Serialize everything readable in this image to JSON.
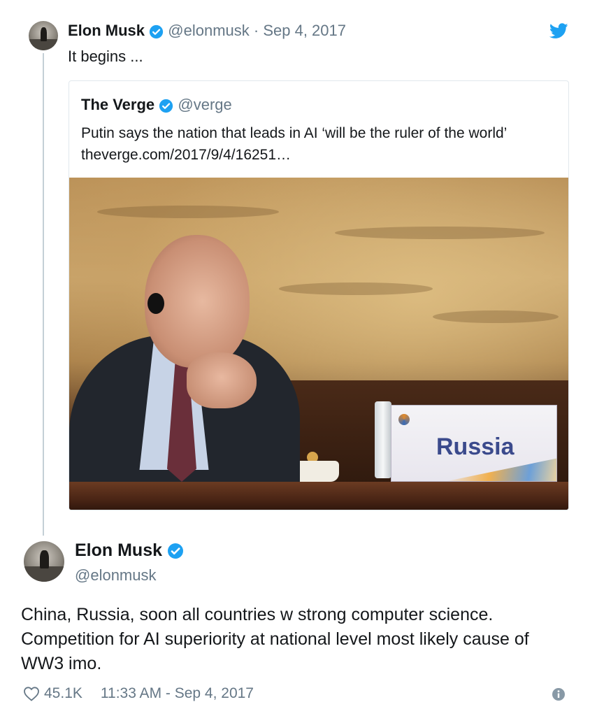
{
  "top_tweet": {
    "author_name": "Elon Musk",
    "handle": "@elonmusk",
    "separator": "·",
    "date": "Sep 4, 2017",
    "text": "It begins ..."
  },
  "quote_tweet": {
    "author_name": "The Verge",
    "handle": "@verge",
    "text": "Putin says the nation that leads in AI ‘will be the ruler of the world’ theverge.com/2017/9/4/16251…",
    "image": {
      "nameplate_text": "Russia"
    }
  },
  "second_tweet": {
    "author_name": "Elon Musk",
    "handle": "@elonmusk",
    "text": "China, Russia, soon all countries w strong computer science. Competition for AI superiority at national level most likely cause of WW3 imo.",
    "likes": "45.1K",
    "timestamp": "11:33 AM - Sep 4, 2017"
  },
  "icons": {
    "verified": "verified-badge-icon",
    "twitter": "twitter-bird-icon",
    "like": "heart-icon",
    "info": "info-icon"
  },
  "colors": {
    "twitter_blue": "#1da1f2",
    "muted_text": "#657786",
    "thread_line": "#c4cfd6",
    "card_border": "#e1e8ed"
  }
}
